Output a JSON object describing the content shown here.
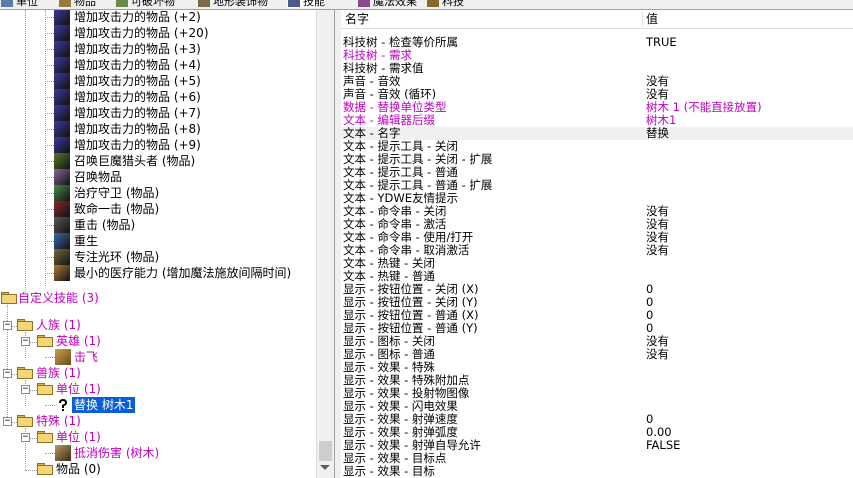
{
  "tabs": [
    {
      "label": "单位",
      "icon": "unit-icon"
    },
    {
      "label": "物品",
      "icon": "item-icon"
    },
    {
      "label": "可破坏物",
      "icon": "destructible-icon"
    },
    {
      "label": "地形装饰物",
      "icon": "doodad-icon"
    },
    {
      "label": "技能",
      "icon": "ability-icon"
    },
    {
      "label": "魔法效果",
      "icon": "buff-icon"
    },
    {
      "label": "科技",
      "icon": "upgrade-icon"
    }
  ],
  "tree": {
    "items": [
      {
        "label": "增加攻击力的物品 (+2)",
        "icon": "attack-item-icon",
        "color": "#3a3a9a"
      },
      {
        "label": "增加攻击力的物品 (+20)",
        "icon": "attack-item-icon",
        "color": "#3a3a9a"
      },
      {
        "label": "增加攻击力的物品 (+3)",
        "icon": "attack-item-icon",
        "color": "#3a3a9a"
      },
      {
        "label": "增加攻击力的物品 (+4)",
        "icon": "attack-item-icon",
        "color": "#3a3a9a"
      },
      {
        "label": "增加攻击力的物品 (+5)",
        "icon": "attack-item-icon",
        "color": "#3a3a9a"
      },
      {
        "label": "增加攻击力的物品 (+6)",
        "icon": "attack-item-icon",
        "color": "#3a3a9a"
      },
      {
        "label": "增加攻击力的物品 (+7)",
        "icon": "attack-item-icon",
        "color": "#3a3a9a"
      },
      {
        "label": "增加攻击力的物品 (+8)",
        "icon": "attack-item-icon",
        "color": "#3a3a9a"
      },
      {
        "label": "增加攻击力的物品 (+9)",
        "icon": "attack-item-icon",
        "color": "#3a3a9a"
      },
      {
        "label": "召唤巨魔猎头者 (物品)",
        "icon": "summon-troll-icon",
        "color": "#5a7a2a"
      },
      {
        "label": "召唤物品",
        "icon": "summon-item-icon",
        "color": "#8a6a9a"
      },
      {
        "label": "治疗守卫 (物品)",
        "icon": "healing-ward-icon",
        "color": "#4a8a4a"
      },
      {
        "label": "致命一击 (物品)",
        "icon": "critical-strike-icon",
        "color": "#8a2a2a"
      },
      {
        "label": "重击 (物品)",
        "icon": "bash-icon",
        "color": "#5a5a5a"
      },
      {
        "label": "重生",
        "icon": "reincarnation-icon",
        "color": "#3a6aaa"
      },
      {
        "label": "专注光环 (物品)",
        "icon": "devotion-aura-icon",
        "color": "#7a6a3a"
      },
      {
        "label": "最小的医疗能力 (增加魔法施放间隔时间)",
        "icon": "heal-icon",
        "color": "#aa7a3a"
      }
    ],
    "custom_root": "自定义技能 (3)",
    "race_human": "人族 (1)",
    "hero": "英雄 (1)",
    "hero_ability": "击飞",
    "race_orc": "兽族 (1)",
    "orc_unit": "单位 (1)",
    "selected_ability": "替换 树木1",
    "special": "特殊 (1)",
    "special_unit": "单位 (1)",
    "special_ability": "抵消伤害 (树木)",
    "items_folder": "物品 (0)"
  },
  "props": {
    "header_name": "名字",
    "header_value": "值",
    "rows": [
      {
        "name": "科技树 - 检查等价所属",
        "value": "TRUE",
        "color": "#000000"
      },
      {
        "name": "科技树 - 需求",
        "value": "",
        "color": "#c000c0"
      },
      {
        "name": "科技树 - 需求值",
        "value": "",
        "color": "#000000"
      },
      {
        "name": "声音 - 音效",
        "value": "没有",
        "color": "#000000"
      },
      {
        "name": "声音 - 音效 (循环)",
        "value": "没有",
        "color": "#000000"
      },
      {
        "name": "数据 - 替换单位类型",
        "value": "树木 1 (不能直接放置)",
        "color": "#c000c0"
      },
      {
        "name": "文本 - 编辑器后缀",
        "value": "树木1",
        "color": "#c000c0"
      },
      {
        "name": "文本 - 名字",
        "value": "替换",
        "color": "#000000"
      },
      {
        "name": "文本 - 提示工具 - 关闭",
        "value": "",
        "color": "#000000"
      },
      {
        "name": "文本 - 提示工具 - 关闭 - 扩展",
        "value": "",
        "color": "#000000"
      },
      {
        "name": "文本 - 提示工具 - 普通",
        "value": "",
        "color": "#000000"
      },
      {
        "name": "文本 - 提示工具 - 普通 - 扩展",
        "value": "",
        "color": "#000000"
      },
      {
        "name": "文本 - YDWE友情提示",
        "value": "",
        "color": "#000000"
      },
      {
        "name": "文本 - 命令串 - 关闭",
        "value": "没有",
        "color": "#000000"
      },
      {
        "name": "文本 - 命令串 - 激活",
        "value": "没有",
        "color": "#000000"
      },
      {
        "name": "文本 - 命令串 - 使用/打开",
        "value": "没有",
        "color": "#000000"
      },
      {
        "name": "文本 - 命令串 - 取消激活",
        "value": "没有",
        "color": "#000000"
      },
      {
        "name": "文本 - 热键 - 关闭",
        "value": "",
        "color": "#000000"
      },
      {
        "name": "文本 - 热键 - 普通",
        "value": "",
        "color": "#000000"
      },
      {
        "name": "显示 - 按钮位置 - 关闭 (X)",
        "value": "0",
        "color": "#000000"
      },
      {
        "name": "显示 - 按钮位置 - 关闭 (Y)",
        "value": "0",
        "color": "#000000"
      },
      {
        "name": "显示 - 按钮位置 - 普通 (X)",
        "value": "0",
        "color": "#000000"
      },
      {
        "name": "显示 - 按钮位置 - 普通 (Y)",
        "value": "0",
        "color": "#000000"
      },
      {
        "name": "显示 - 图标 - 关闭",
        "value": "没有",
        "color": "#000000"
      },
      {
        "name": "显示 - 图标 - 普通",
        "value": "没有",
        "color": "#000000"
      },
      {
        "name": "显示 - 效果 - 特殊",
        "value": "",
        "color": "#000000"
      },
      {
        "name": "显示 - 效果 - 特殊附加点",
        "value": "",
        "color": "#000000"
      },
      {
        "name": "显示 - 效果 - 投射物图像",
        "value": "",
        "color": "#000000"
      },
      {
        "name": "显示 - 效果 - 闪电效果",
        "value": "",
        "color": "#000000"
      },
      {
        "name": "显示 - 效果 - 射弹速度",
        "value": "0",
        "color": "#000000"
      },
      {
        "name": "显示 - 效果 - 射弹弧度",
        "value": "0.00",
        "color": "#000000"
      },
      {
        "name": "显示 - 效果 - 射弹自导允许",
        "value": "FALSE",
        "color": "#000000"
      },
      {
        "name": "显示 - 效果 - 目标点",
        "value": "",
        "color": "#000000"
      },
      {
        "name": "显示 - 效果 - 目标",
        "value": "",
        "color": "#000000"
      }
    ]
  }
}
